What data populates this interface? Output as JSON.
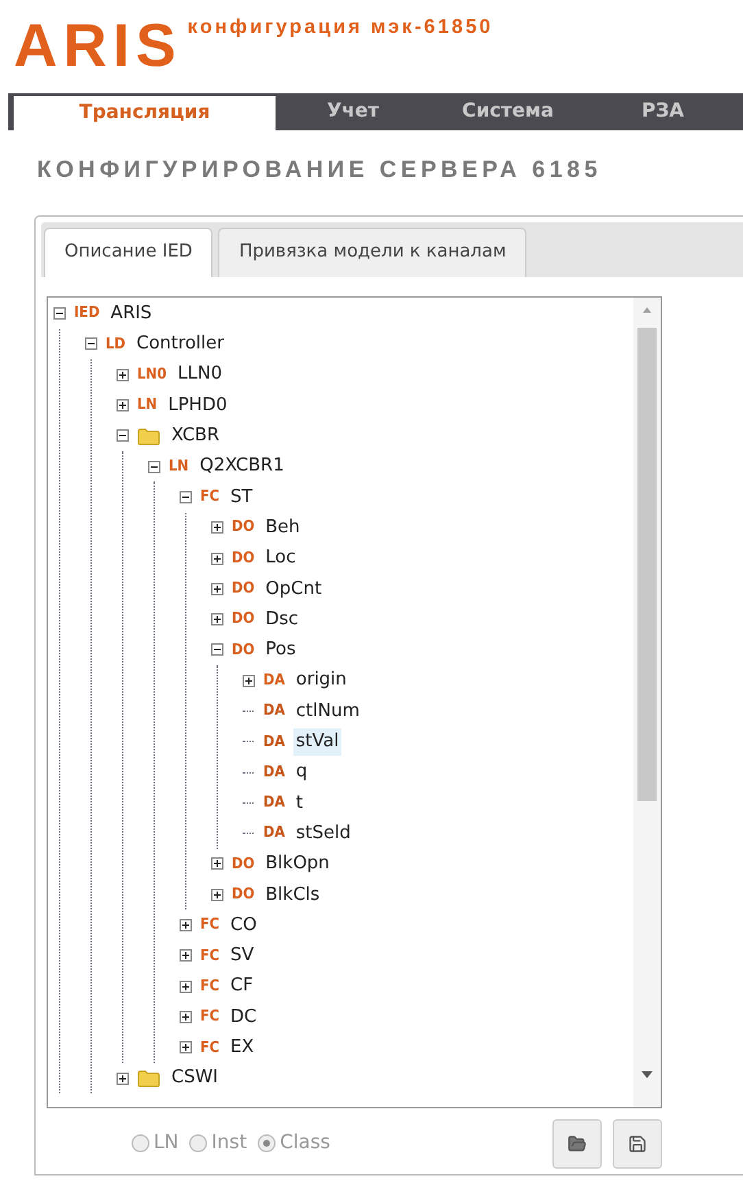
{
  "header": {
    "logo": "ARIS",
    "subtitle": "конфигурация мэк-61850"
  },
  "nav_tabs": [
    {
      "label": "Трансляция",
      "selected": true
    },
    {
      "label": "Учет",
      "selected": false
    },
    {
      "label": "Система",
      "selected": false
    },
    {
      "label": "РЗА",
      "selected": false
    }
  ],
  "page_title": "КОНФИГУРИРОВАНИЕ СЕРВЕРА 6185",
  "panel_tabs": [
    {
      "label": "Описание IED",
      "selected": true
    },
    {
      "label": "Привязка модели к каналам",
      "selected": false
    }
  ],
  "tree": [
    {
      "kind": "node",
      "tag": "IED",
      "name": "ARIS",
      "expanded": true,
      "selected": false,
      "children": [
        {
          "kind": "node",
          "tag": "LD",
          "name": "Controller",
          "expanded": true,
          "selected": false,
          "children": [
            {
              "kind": "node",
              "tag": "LN0",
              "name": "LLN0",
              "expanded": false,
              "selected": false
            },
            {
              "kind": "node",
              "tag": "LN",
              "name": "LPHD0",
              "expanded": false,
              "selected": false
            },
            {
              "kind": "folder",
              "name": "XCBR",
              "expanded": true,
              "selected": false,
              "children": [
                {
                  "kind": "node",
                  "tag": "LN",
                  "name": "Q2XCBR1",
                  "expanded": true,
                  "selected": false,
                  "children": [
                    {
                      "kind": "node",
                      "tag": "FC",
                      "name": "ST",
                      "expanded": true,
                      "selected": false,
                      "children": [
                        {
                          "kind": "node",
                          "tag": "DO",
                          "name": "Beh",
                          "expanded": false,
                          "selected": false
                        },
                        {
                          "kind": "node",
                          "tag": "DO",
                          "name": "Loc",
                          "expanded": false,
                          "selected": false
                        },
                        {
                          "kind": "node",
                          "tag": "DO",
                          "name": "OpCnt",
                          "expanded": false,
                          "selected": false
                        },
                        {
                          "kind": "node",
                          "tag": "DO",
                          "name": "Dsc",
                          "expanded": false,
                          "selected": false
                        },
                        {
                          "kind": "node",
                          "tag": "DO",
                          "name": "Pos",
                          "expanded": true,
                          "selected": false,
                          "children": [
                            {
                              "kind": "node",
                              "tag": "DA",
                              "name": "origin",
                              "expanded": false,
                              "selected": false
                            },
                            {
                              "kind": "leaf",
                              "tag": "DA",
                              "name": "ctlNum",
                              "selected": false
                            },
                            {
                              "kind": "leaf",
                              "tag": "DA",
                              "name": "stVal",
                              "selected": true
                            },
                            {
                              "kind": "leaf",
                              "tag": "DA",
                              "name": "q",
                              "selected": false
                            },
                            {
                              "kind": "leaf",
                              "tag": "DA",
                              "name": "t",
                              "selected": false
                            },
                            {
                              "kind": "leaf",
                              "tag": "DA",
                              "name": "stSeld",
                              "selected": false
                            }
                          ]
                        },
                        {
                          "kind": "node",
                          "tag": "DO",
                          "name": "BlkOpn",
                          "expanded": false,
                          "selected": false
                        },
                        {
                          "kind": "node",
                          "tag": "DO",
                          "name": "BlkCls",
                          "expanded": false,
                          "selected": false
                        }
                      ]
                    },
                    {
                      "kind": "node",
                      "tag": "FC",
                      "name": "CO",
                      "expanded": false,
                      "selected": false
                    },
                    {
                      "kind": "node",
                      "tag": "FC",
                      "name": "SV",
                      "expanded": false,
                      "selected": false
                    },
                    {
                      "kind": "node",
                      "tag": "FC",
                      "name": "CF",
                      "expanded": false,
                      "selected": false
                    },
                    {
                      "kind": "node",
                      "tag": "FC",
                      "name": "DC",
                      "expanded": false,
                      "selected": false
                    },
                    {
                      "kind": "node",
                      "tag": "FC",
                      "name": "EX",
                      "expanded": false,
                      "selected": false
                    }
                  ]
                }
              ]
            },
            {
              "kind": "folder",
              "name": "CSWI",
              "expanded": false,
              "selected": false
            }
          ]
        }
      ]
    }
  ],
  "view_options": [
    {
      "label": "LN",
      "selected": false
    },
    {
      "label": "Inst",
      "selected": false
    },
    {
      "label": "Class",
      "selected": true
    }
  ]
}
